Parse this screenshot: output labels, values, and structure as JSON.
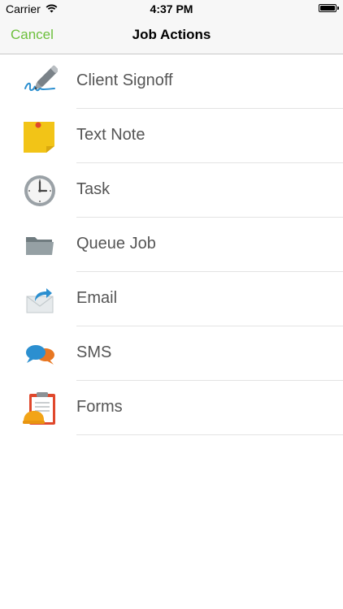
{
  "status_bar": {
    "carrier": "Carrier",
    "time": "4:37 PM"
  },
  "nav": {
    "cancel_label": "Cancel",
    "title": "Job Actions",
    "accent_color": "#6cbf3b"
  },
  "actions": [
    {
      "label": "Client Signoff",
      "icon": "signature-pen-icon"
    },
    {
      "label": "Text Note",
      "icon": "sticky-note-icon"
    },
    {
      "label": "Task",
      "icon": "clock-icon"
    },
    {
      "label": "Queue Job",
      "icon": "folder-icon"
    },
    {
      "label": "Email",
      "icon": "email-forward-icon"
    },
    {
      "label": "SMS",
      "icon": "chat-bubbles-icon"
    },
    {
      "label": "Forms",
      "icon": "clipboard-form-icon"
    }
  ]
}
